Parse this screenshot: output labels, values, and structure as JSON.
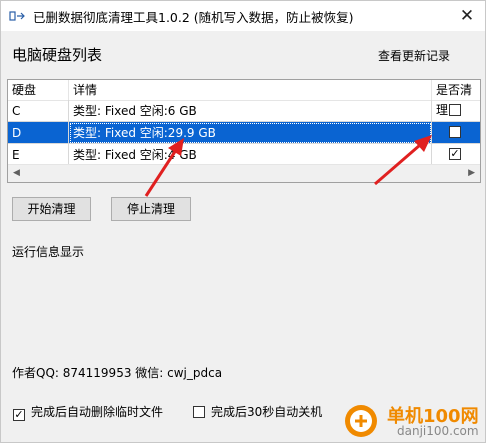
{
  "window": {
    "title": "已删数据彻底清理工具1.0.2 (随机写入数据，防止被恢复)",
    "close_symbol": "✕"
  },
  "section_title": "电脑硬盘列表",
  "changelog_label": "查看更新记录",
  "table": {
    "headers": {
      "disk": "硬盘",
      "detail": "详情",
      "clean": "是否清理"
    },
    "rows": [
      {
        "disk": "C",
        "detail": "类型: Fixed 空闲:6 GB",
        "checked": "",
        "selected": false
      },
      {
        "disk": "D",
        "detail": "类型: Fixed 空闲:29.9 GB",
        "checked": "",
        "selected": true
      },
      {
        "disk": "E",
        "detail": "类型: Fixed 空闲:4 GB",
        "checked": "✓",
        "selected": false
      }
    ],
    "scroll_left": "◀",
    "scroll_right": "▶"
  },
  "buttons": {
    "start": "开始清理",
    "stop": "停止清理"
  },
  "info_label": "运行信息显示",
  "author_line": "作者QQ: 874119953  微信: cwj_pdca",
  "options": [
    {
      "label": "完成后自动删除临时文件",
      "checked": "✓"
    },
    {
      "label": "完成后30秒自动关机",
      "checked": ""
    }
  ],
  "watermark": {
    "brand": "单机100网",
    "url": "danji100.com"
  },
  "colors": {
    "selection": "#0a64d2",
    "arrow": "#e02020",
    "brand": "#f08a00"
  }
}
